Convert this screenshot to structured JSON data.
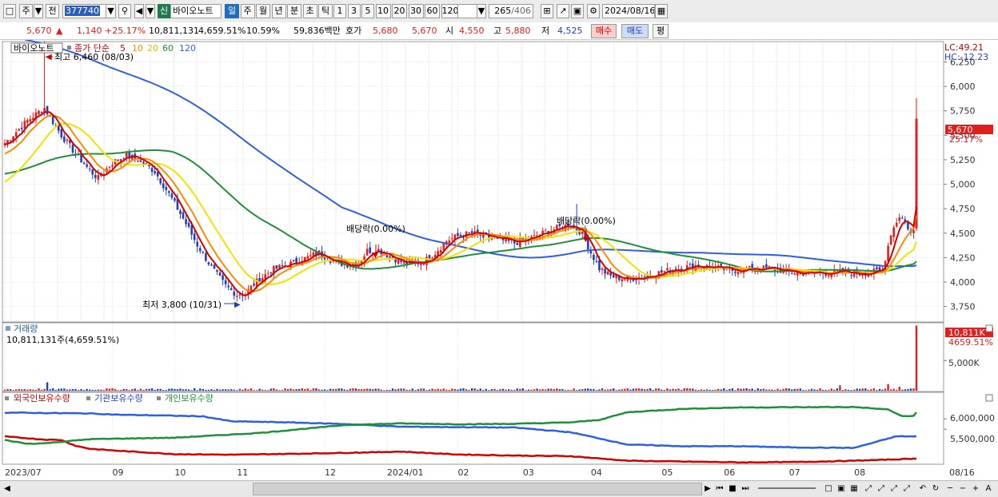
{
  "toolbar": {
    "period_label": "주",
    "prev_label": "전",
    "code_value": "377740",
    "sin_badge": "신",
    "stock_name": "바이오노트",
    "period_buttons": [
      "일",
      "주",
      "월",
      "년",
      "분",
      "초",
      "틱"
    ],
    "period_selected": "일",
    "number_buttons": [
      "1",
      "3",
      "5",
      "10",
      "20",
      "30",
      "60",
      "120"
    ],
    "count_value": "265",
    "count_total": "/406",
    "date_value": "2024/08/16"
  },
  "infobar": {
    "price": "5,670",
    "change": "1,140",
    "change_pct": "+25.17%",
    "volume": "10,811,131",
    "volume_pct": "4,659.51%",
    "turnover": "10.59%",
    "amount": "59,836백만",
    "quote_label": "호가",
    "quote_ask": "5,680",
    "quote_bid": "5,670",
    "open_label": "시",
    "open": "4,550",
    "high_label": "고",
    "high": "5,880",
    "low_label": "저",
    "low": "4,525",
    "buy_label": "매수",
    "sell_label": "매도",
    "avg_label": "평"
  },
  "colors": {
    "candle_up": "#e0201c",
    "candle_down": "#1f3fbf",
    "ma5": "#d40000",
    "ma10": "#ff8a00",
    "ma20": "#f2e300",
    "ma60": "#1f8f3a",
    "ma120": "#2d5fe0",
    "foreign": "#d40000",
    "institution": "#2d5fe0",
    "individual": "#1f8f3a"
  },
  "chart_data": [
    {
      "type": "candlestick",
      "title": "바이오노트",
      "legend_prefix": "종가 단순",
      "ma_periods": [
        "5",
        "10",
        "20",
        "60",
        "120"
      ],
      "ylim": [
        3600,
        6450
      ],
      "y_ticks": [
        3750,
        4000,
        4250,
        4500,
        4750,
        5000,
        5250,
        5500,
        5750,
        6000,
        6250
      ],
      "y_tick_labels": [
        "3,750",
        "4,000",
        "4,250",
        "4,500",
        "4,750",
        "5,000",
        "5,250",
        "5,500",
        "5,750",
        "6,000",
        "6,250"
      ],
      "x_labels": [
        "2023/07",
        "09",
        "10",
        "11",
        "12",
        "2024/01",
        "02",
        "03",
        "04",
        "05",
        "06",
        "07",
        "08",
        "08/16"
      ],
      "annotations": [
        {
          "text": "최고 6,460 (08/03)"
        },
        {
          "text": "최저 3,800 (10/31)"
        },
        {
          "text": "배당락(0.00%)"
        },
        {
          "text": "배당락(0.00%)"
        }
      ],
      "top_right_labels": [
        "LC:49.21",
        "HC:-12.23"
      ],
      "last_price_label": "5,670",
      "last_change_label": "25.17%",
      "close_anchors": [
        [
          0,
          5420
        ],
        [
          8,
          5650
        ],
        [
          14,
          5780
        ],
        [
          20,
          5500
        ],
        [
          24,
          5350
        ],
        [
          30,
          5140
        ],
        [
          33,
          5060
        ],
        [
          38,
          5220
        ],
        [
          43,
          5300
        ],
        [
          48,
          5240
        ],
        [
          53,
          5130
        ],
        [
          58,
          4900
        ],
        [
          63,
          4650
        ],
        [
          68,
          4380
        ],
        [
          73,
          4150
        ],
        [
          78,
          3960
        ],
        [
          82,
          3870
        ],
        [
          85,
          3880
        ],
        [
          88,
          3980
        ],
        [
          94,
          4120
        ],
        [
          100,
          4180
        ],
        [
          106,
          4240
        ],
        [
          111,
          4300
        ],
        [
          115,
          4230
        ],
        [
          120,
          4180
        ],
        [
          125,
          4190
        ],
        [
          128,
          4320
        ],
        [
          132,
          4330
        ],
        [
          137,
          4250
        ],
        [
          142,
          4180
        ],
        [
          148,
          4210
        ],
        [
          152,
          4300
        ],
        [
          156,
          4420
        ],
        [
          160,
          4470
        ],
        [
          165,
          4500
        ],
        [
          170,
          4460
        ],
        [
          175,
          4430
        ],
        [
          180,
          4400
        ],
        [
          186,
          4450
        ],
        [
          191,
          4510
        ],
        [
          196,
          4560
        ],
        [
          200,
          4590
        ],
        [
          204,
          4500
        ],
        [
          207,
          4300
        ],
        [
          210,
          4140
        ],
        [
          214,
          4060
        ],
        [
          220,
          4030
        ],
        [
          226,
          4060
        ],
        [
          232,
          4100
        ],
        [
          238,
          4140
        ],
        [
          244,
          4170
        ],
        [
          250,
          4150
        ],
        [
          256,
          4120
        ],
        [
          262,
          4130
        ],
        [
          270,
          4140
        ],
        [
          278,
          4100
        ],
        [
          286,
          4090
        ],
        [
          294,
          4100
        ],
        [
          300,
          4090
        ],
        [
          306,
          4100
        ],
        [
          310,
          4120
        ],
        [
          313,
          4500
        ],
        [
          316,
          4680
        ],
        [
          318,
          4620
        ],
        [
          320,
          4500
        ],
        [
          321,
          4530
        ],
        [
          322,
          5670
        ]
      ]
    },
    {
      "type": "bar",
      "title": "거래량",
      "label": "10,811,131주(4,659.51%)",
      "tick_label": "5,000K",
      "last_value_label": "10,811K",
      "last_pct_label": "4659.51%",
      "last_volume": 10811131,
      "baseline_volume": 232000,
      "spikes": [
        [
          15,
          1400000
        ],
        [
          295,
          900000
        ],
        [
          312,
          1100000
        ],
        [
          316,
          650000
        ]
      ]
    },
    {
      "type": "line",
      "series": [
        {
          "name": "외국인보유수량",
          "values": [
            [
              0,
              5150000
            ],
            [
              14,
              5000000
            ],
            [
              20,
              4980000
            ],
            [
              25,
              4700000
            ],
            [
              30,
              4560000
            ],
            [
              40,
              4460000
            ],
            [
              60,
              4300000
            ],
            [
              80,
              4270000
            ],
            [
              100,
              4310000
            ],
            [
              120,
              4360000
            ],
            [
              140,
              4420000
            ],
            [
              160,
              4280000
            ],
            [
              180,
              4230000
            ],
            [
              200,
              4200000
            ],
            [
              220,
              3980000
            ],
            [
              240,
              3940000
            ],
            [
              260,
              3900000
            ],
            [
              280,
              3920000
            ],
            [
              300,
              3980000
            ],
            [
              315,
              4050000
            ],
            [
              322,
              4080000
            ]
          ]
        },
        {
          "name": "기관보유수량",
          "values": [
            [
              0,
              6300000
            ],
            [
              30,
              6260000
            ],
            [
              40,
              6200000
            ],
            [
              60,
              6150000
            ],
            [
              70,
              6120000
            ],
            [
              80,
              5880000
            ],
            [
              100,
              5830000
            ],
            [
              120,
              5750000
            ],
            [
              140,
              5620000
            ],
            [
              160,
              5600000
            ],
            [
              180,
              5580000
            ],
            [
              200,
              5350000
            ],
            [
              220,
              4760000
            ],
            [
              240,
              4680000
            ],
            [
              260,
              4680000
            ],
            [
              280,
              4620000
            ],
            [
              300,
              4600000
            ],
            [
              315,
              5160000
            ],
            [
              322,
              5150000
            ]
          ]
        },
        {
          "name": "개인보유수량",
          "values": [
            [
              0,
              4980000
            ],
            [
              8,
              4800000
            ],
            [
              14,
              4820000
            ],
            [
              30,
              5020000
            ],
            [
              60,
              5090000
            ],
            [
              90,
              5320000
            ],
            [
              120,
              5700000
            ],
            [
              140,
              5780000
            ],
            [
              160,
              5740000
            ],
            [
              180,
              5760000
            ],
            [
              200,
              5830000
            ],
            [
              210,
              5950000
            ],
            [
              220,
              6320000
            ],
            [
              240,
              6480000
            ],
            [
              260,
              6550000
            ],
            [
              280,
              6560000
            ],
            [
              300,
              6570000
            ],
            [
              312,
              6450000
            ],
            [
              317,
              6120000
            ],
            [
              321,
              6140000
            ],
            [
              322,
              6330000
            ]
          ]
        }
      ],
      "y_tick_labels": [
        "5,500,000",
        "6,000,000"
      ]
    }
  ]
}
